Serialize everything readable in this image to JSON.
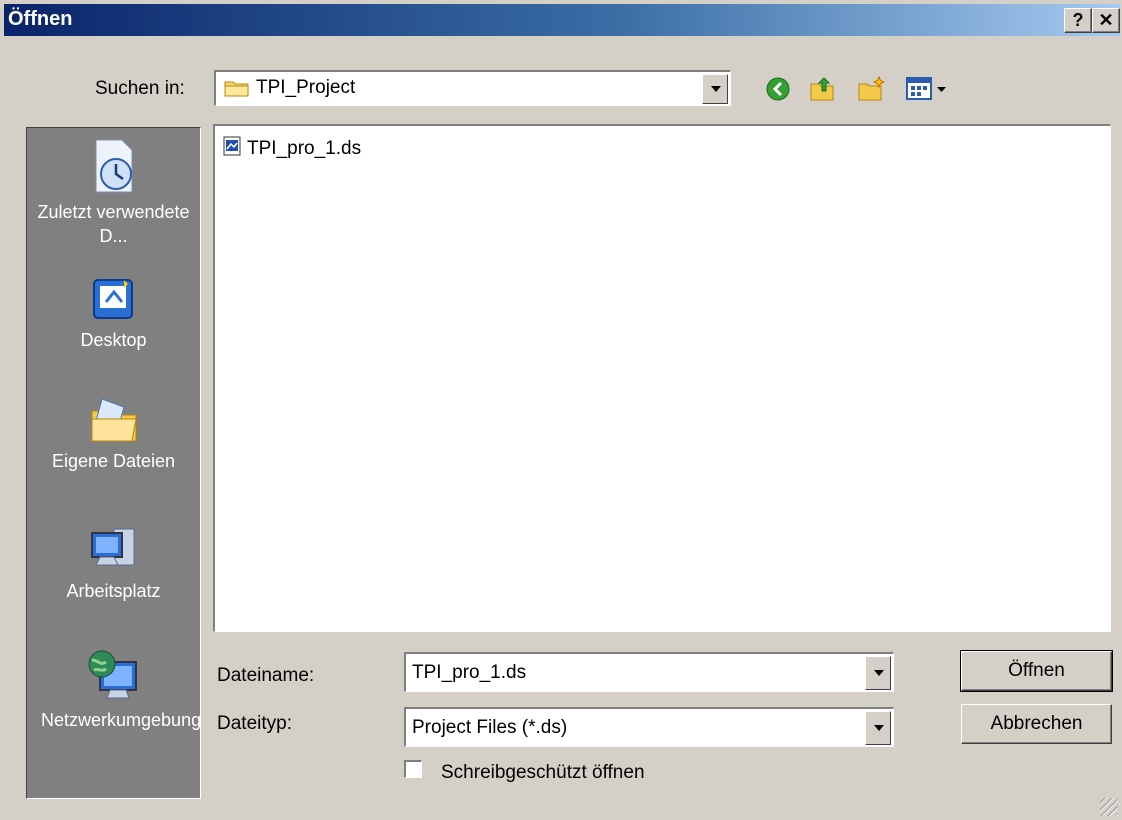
{
  "window": {
    "title": "Öffnen",
    "help_label": "?",
    "close_label": "✕"
  },
  "lookin": {
    "label": "Suchen in:",
    "value": "TPI_Project"
  },
  "toolbar": {
    "icons": [
      "back-icon",
      "up-folder-icon",
      "new-folder-icon",
      "view-menu-icon"
    ]
  },
  "places": [
    {
      "label": "Zuletzt verwendete D...",
      "icon": "recent-documents-icon"
    },
    {
      "label": "Desktop",
      "icon": "desktop-icon"
    },
    {
      "label": "Eigene Dateien",
      "icon": "my-documents-icon"
    },
    {
      "label": "Arbeitsplatz",
      "icon": "my-computer-icon"
    },
    {
      "label": "Netzwerkumgebung",
      "icon": "network-icon"
    }
  ],
  "files": [
    {
      "name": "TPI_pro_1.ds",
      "icon": "ds-file-icon"
    }
  ],
  "filename": {
    "label": "Dateiname:",
    "value": "TPI_pro_1.ds"
  },
  "filetype": {
    "label": "Dateityp:",
    "value": "Project Files (*.ds)"
  },
  "readonly": {
    "label": "Schreibgeschützt öffnen",
    "checked": false
  },
  "buttons": {
    "open": "Öffnen",
    "cancel": "Abbrechen"
  }
}
